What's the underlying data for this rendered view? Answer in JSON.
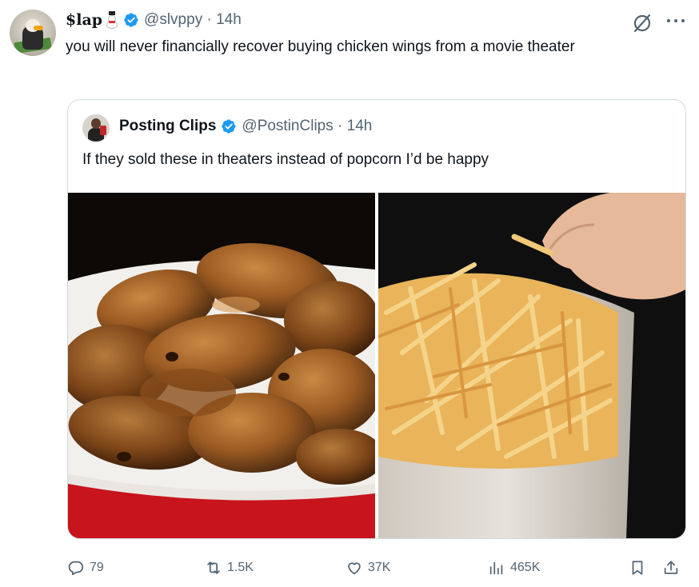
{
  "tweet": {
    "display_name": "$lap",
    "handle": "@slvppy",
    "time": "14h",
    "separator": " · ",
    "text": "you will never financially recover buying chicken wings from a movie theater"
  },
  "quoted_tweet": {
    "display_name": "Posting Clips",
    "handle": "@PostinClips",
    "time": "14h",
    "separator": " · ",
    "text": "If they sold these in theaters instead of popcorn I’d be happy"
  },
  "actions": {
    "replies": "79",
    "retweets": "1.5K",
    "likes": "37K",
    "views": "465K"
  },
  "colors": {
    "text": "#0f1419",
    "secondary": "#536471",
    "verified": "#1d9bf0",
    "border": "#cfd9de"
  },
  "icons": [
    "verified-badge-icon",
    "mute-icon",
    "more-icon",
    "reply-icon",
    "retweet-icon",
    "like-icon",
    "views-icon",
    "bookmark-icon",
    "share-icon"
  ]
}
